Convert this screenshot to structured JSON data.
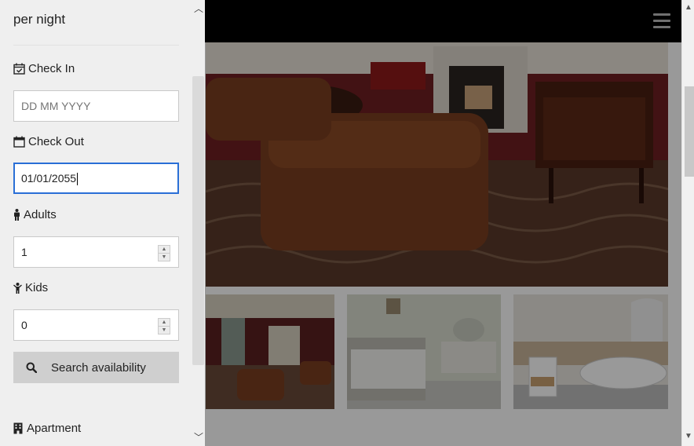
{
  "sidebar": {
    "price_label": "per night",
    "check_in": {
      "label": "Check In",
      "placeholder": "DD MM YYYY",
      "value": ""
    },
    "check_out": {
      "label": "Check Out",
      "value": "01/01/2055"
    },
    "adults": {
      "label": "Adults",
      "value": "1"
    },
    "kids": {
      "label": "Kids",
      "value": "0"
    },
    "search_button": "Search availability",
    "apartment_label": "Apartment"
  },
  "icons": {
    "check_in": "calendar-check-icon",
    "check_out": "calendar-icon",
    "adults": "male-icon",
    "kids": "child-icon",
    "search": "search-icon",
    "apartment": "building-icon",
    "menu": "hamburger-menu-icon"
  },
  "colors": {
    "focus_border": "#2a6fd6",
    "sidebar_bg": "#efefef",
    "button_bg": "#cfcfcf",
    "topbar_bg": "#000000"
  }
}
